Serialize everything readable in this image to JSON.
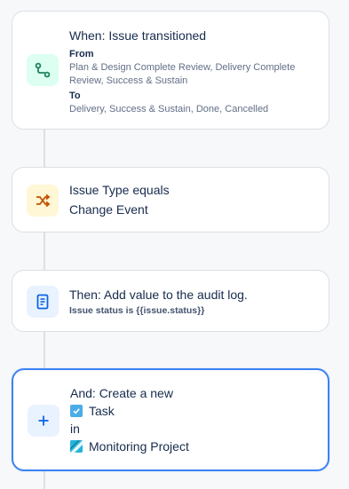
{
  "trigger": {
    "title": "When: Issue transitioned",
    "from_label": "From",
    "from_value": "Plan & Design Complete Review, Delivery Complete Review, Success & Sustain",
    "to_label": "To",
    "to_value": "Delivery, Success & Sustain, Done, Cancelled",
    "icon": "transition-icon"
  },
  "condition": {
    "line1": "Issue Type equals",
    "line2": "Change Event",
    "icon": "shuffle-icon"
  },
  "action1": {
    "title": "Then: Add value to the audit log.",
    "detail": "Issue status is {{issue.status}}",
    "icon": "document-icon"
  },
  "action2": {
    "title": "And: Create a new",
    "issue_type": "Task",
    "in_label": "in",
    "project": "Monitoring Project",
    "icon": "plus-icon"
  },
  "colors": {
    "trigger_bg": "#dcfff1",
    "trigger_fg": "#1f845a",
    "condition_bg": "#fff7d6",
    "condition_fg": "#c25100",
    "action_bg": "#e9f2ff",
    "action_fg": "#0c66e4",
    "selected_border": "#3b82f6"
  }
}
